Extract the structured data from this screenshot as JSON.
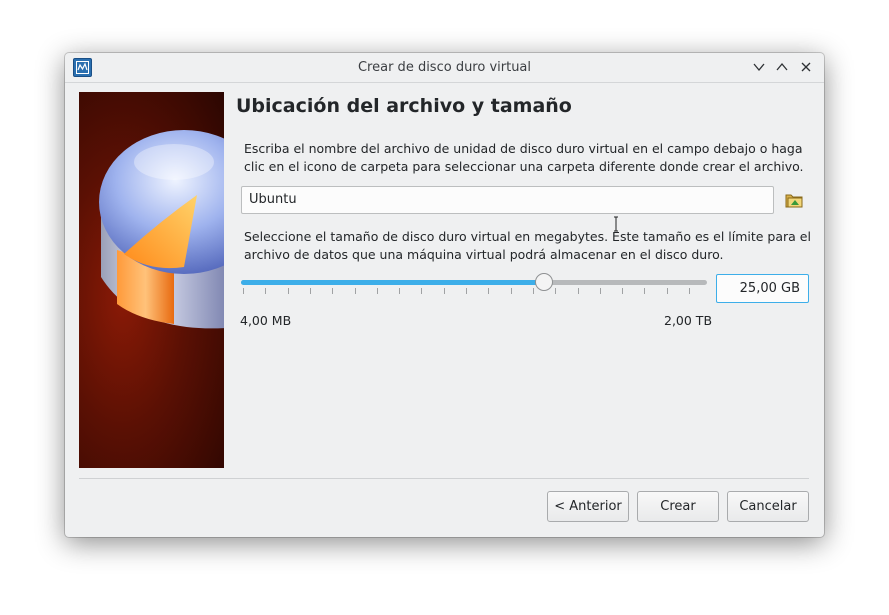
{
  "window": {
    "title": "Crear de disco duro virtual"
  },
  "icons": {
    "app": "virtualbox-icon",
    "minimize": "chevron-down-icon",
    "maximize": "chevron-up-icon",
    "close": "close-icon",
    "folder": "folder-open-icon"
  },
  "page": {
    "heading": "Ubicación del archivo y tamaño",
    "location_description": "Escriba el nombre del archivo de unidad de disco duro virtual en el campo debajo o haga clic en el icono de carpeta para seleccionar una carpeta diferente donde crear el archivo.",
    "file_name": "Ubuntu",
    "size_description": "Seleccione el tamaño de disco duro virtual en megabytes. Este tamaño es el límite para el archivo de datos que una máquina virtual podrá almacenar en el disco duro.",
    "size_value": "25,00 GB",
    "slider_fraction": 0.65,
    "min_label": "4,00 MB",
    "max_label": "2,00 TB"
  },
  "buttons": {
    "back": "< Anterior",
    "create": "Crear",
    "cancel": "Cancelar"
  },
  "colors": {
    "accent": "#3daee9",
    "window_bg": "#eff0f1"
  }
}
